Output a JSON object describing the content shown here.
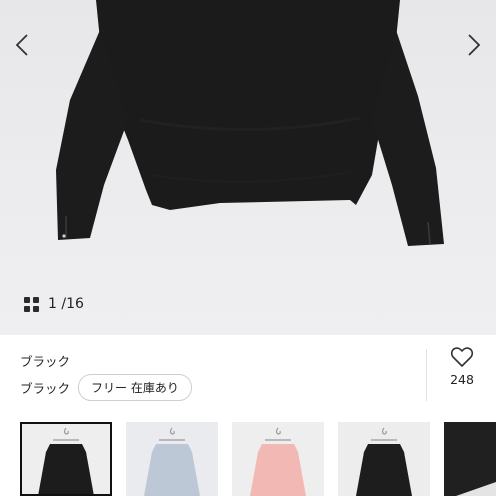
{
  "gallery": {
    "prev_icon": "chevron-left-icon",
    "next_icon": "chevron-right-icon",
    "grid_icon": "grid-icon",
    "counter_text": "1 /16"
  },
  "product": {
    "color_name": "ブラック",
    "variant_label": "ブラック",
    "size_chip": "フリー 在庫あり",
    "favorite_icon": "heart-icon",
    "favorite_count": "248"
  },
  "thumbnails": [
    {
      "color": "#1c1c1c",
      "bg": "#eeeeef",
      "selected": true
    },
    {
      "color": "#bcc8d6",
      "bg": "#e9ebee",
      "selected": false
    },
    {
      "color": "#f2b9b4",
      "bg": "#eeeeee",
      "selected": false
    },
    {
      "color": "#1d1d1d",
      "bg": "#ededee",
      "selected": false
    },
    {
      "color": "#202020",
      "bg": "#e4e4e5",
      "selected": false
    }
  ],
  "colors": {
    "hero_bg": "#eaeaec",
    "garment": "#1b1b1b",
    "accent_border": "#111111"
  }
}
